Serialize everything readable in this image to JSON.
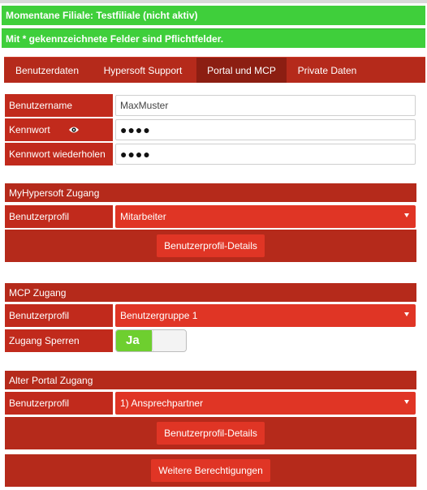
{
  "banners": {
    "branch": "Momentane Filiale: Testfiliale (nicht aktiv)",
    "required_note": "Mit * gekennzeichnete Felder sind Pflichtfelder."
  },
  "tabs": [
    {
      "label": "Benutzerdaten"
    },
    {
      "label": "Hypersoft Support"
    },
    {
      "label": "Portal und MCP",
      "active": true
    },
    {
      "label": "Private Daten"
    }
  ],
  "login": {
    "username_label": "Benutzername",
    "username_value": "MaxMuster",
    "password_label": "Kennwort",
    "password_value": "●●●●",
    "password_repeat_label": "Kennwort wiederholen",
    "password_repeat_value": "●●●●",
    "eye_icon": "eye-icon"
  },
  "myhypersoft": {
    "title": "MyHypersoft Zugang",
    "profile_label": "Benutzerprofil",
    "profile_value": "Mitarbeiter",
    "details_button": "Benutzerprofil-Details"
  },
  "mcp": {
    "title": "MCP Zugang",
    "profile_label": "Benutzerprofil",
    "profile_value": "Benutzergruppe 1",
    "lock_label": "Zugang Sperren",
    "lock_toggle": "Ja"
  },
  "old_portal": {
    "title": "Alter Portal Zugang",
    "profile_label": "Benutzerprofil",
    "profile_value": "1) Ansprechpartner",
    "details_button": "Benutzerprofil-Details",
    "more_button": "Weitere Berechtigungen"
  },
  "colors": {
    "banner_green": "#3fcf3b",
    "header_red": "#b52a1b",
    "label_red": "#c12a1c",
    "control_red": "#e03525",
    "active_tab": "#8c1e12",
    "toggle_green": "#6ecf2f"
  }
}
